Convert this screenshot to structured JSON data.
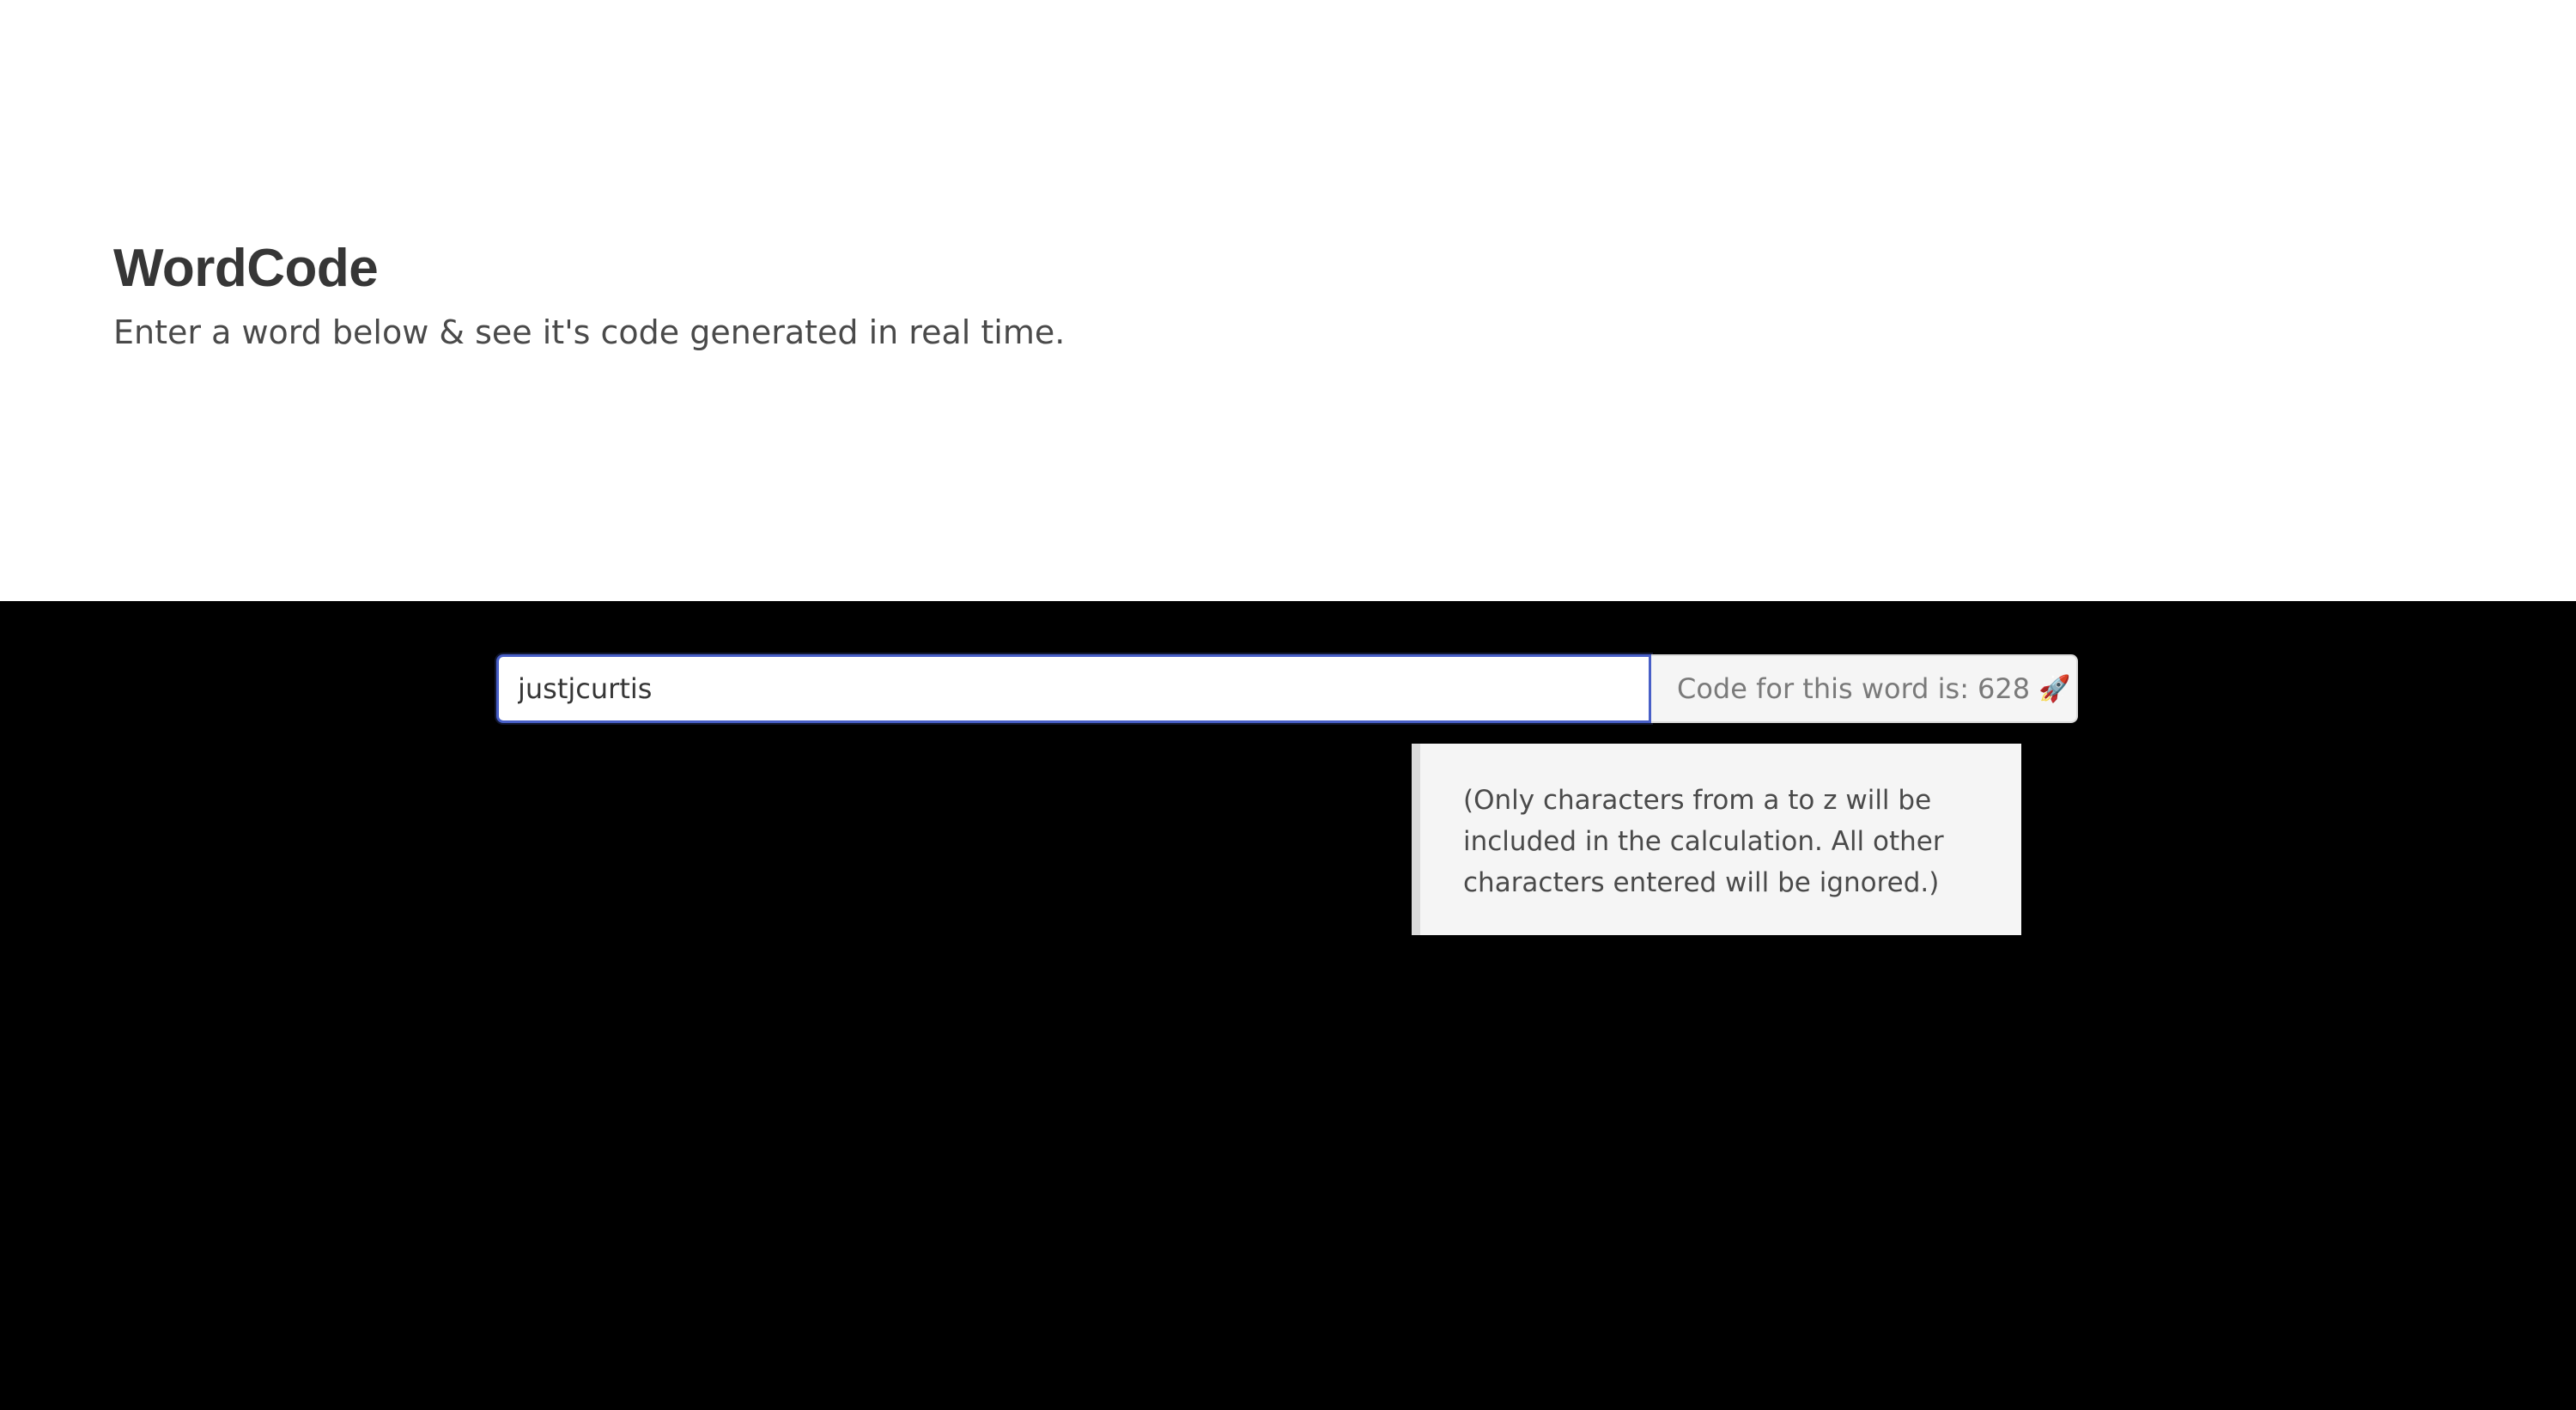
{
  "hero": {
    "title": "WordCode",
    "subtitle": "Enter a word below & see it's code generated in real time."
  },
  "form": {
    "input_value": "justjcurtis",
    "code_label": "Code for this word is:",
    "code_value": "628",
    "code_icon": "rocket-icon",
    "accent_color": "#485fc7"
  },
  "note": {
    "line1": "(Only characters from a to z will be",
    "line2": "included in the calculation. All other",
    "line3": "characters entered will be ignored.)"
  }
}
